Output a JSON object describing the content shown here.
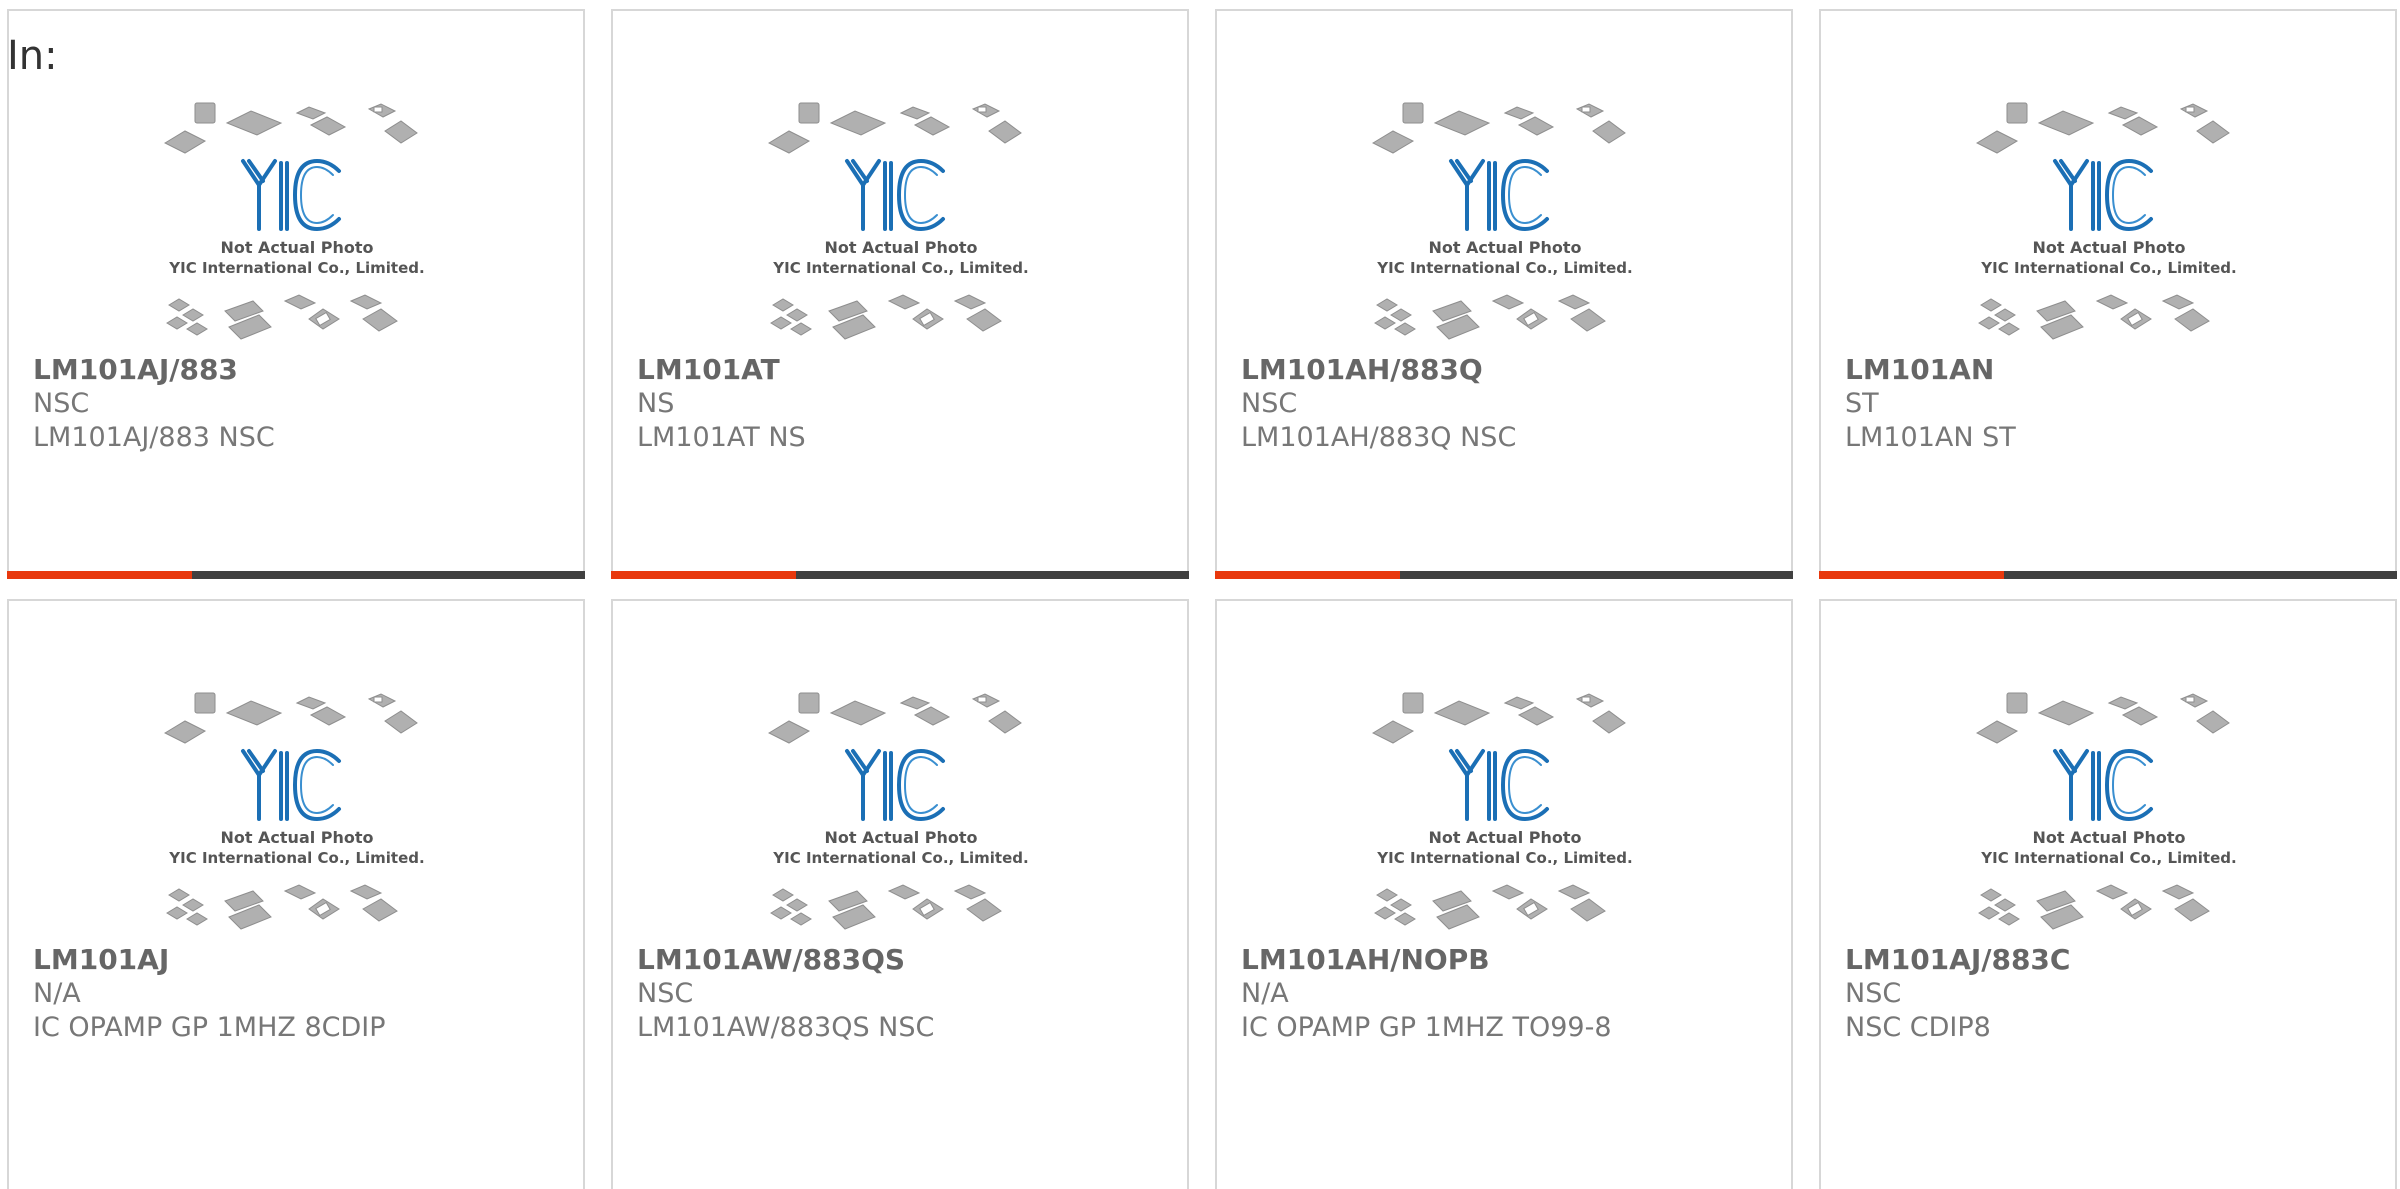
{
  "header": {
    "label": "In:"
  },
  "placeholder": {
    "logo_text": "YIC",
    "line1": "Not Actual Photo",
    "line2": "YIC International Co., Limited."
  },
  "colors": {
    "accent": "#e8380d",
    "bar_track": "#404040",
    "logo_blue": "#1b6fb5",
    "chip_gray": "#a9a9a9"
  },
  "products": [
    {
      "part": "LM101AJ/883",
      "brand": "NSC",
      "desc": "LM101AJ/883 NSC",
      "progress": 0.32
    },
    {
      "part": "LM101AT",
      "brand": "NS",
      "desc": "LM101AT NS",
      "progress": 0.32
    },
    {
      "part": "LM101AH/883Q",
      "brand": "NSC",
      "desc": "LM101AH/883Q NSC",
      "progress": 0.32
    },
    {
      "part": "LM101AN",
      "brand": "ST",
      "desc": "LM101AN ST",
      "progress": 0.32
    },
    {
      "part": "LM101AJ",
      "brand": "N/A",
      "desc": "IC OPAMP GP 1MHZ 8CDIP"
    },
    {
      "part": "LM101AW/883QS",
      "brand": "NSC",
      "desc": "LM101AW/883QS NSC"
    },
    {
      "part": "LM101AH/NOPB",
      "brand": "N/A",
      "desc": "IC OPAMP GP 1MHZ TO99-8"
    },
    {
      "part": "LM101AJ/883C",
      "brand": "NSC",
      "desc": "NSC CDIP8"
    }
  ]
}
